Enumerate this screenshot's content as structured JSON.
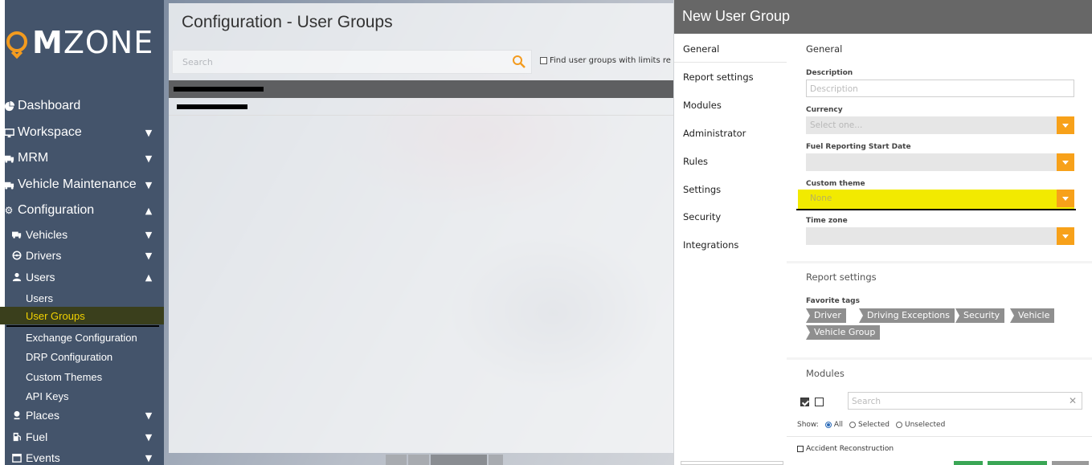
{
  "logo": {
    "bold": "M",
    "rest": "ZONE"
  },
  "nav": [
    {
      "label": "Dashboard",
      "icon": "pie-chart-icon",
      "chevron": ""
    },
    {
      "label": "Workspace",
      "icon": "monitor-icon",
      "chevron": "down"
    },
    {
      "label": "MRM",
      "icon": "truck-icon",
      "chevron": "down"
    },
    {
      "label": "Vehicle Maintenance",
      "icon": "truck-icon",
      "chevron": "down"
    },
    {
      "label": "Configuration",
      "icon": "gear-icon",
      "chevron": "up"
    },
    {
      "label": "Vehicles",
      "icon": "truck-icon",
      "chevron": "down"
    },
    {
      "label": "Drivers",
      "icon": "steering-wheel-icon",
      "chevron": "down"
    },
    {
      "label": "Users",
      "icon": "user-icon",
      "chevron": "up"
    },
    {
      "label": "Users"
    },
    {
      "label": "User Groups",
      "active": true
    },
    {
      "label": "Exchange Configuration"
    },
    {
      "label": "DRP Configuration"
    },
    {
      "label": "Custom Themes"
    },
    {
      "label": "API Keys"
    },
    {
      "label": "Places",
      "icon": "map-pin-icon",
      "chevron": "down"
    },
    {
      "label": "Fuel",
      "icon": "fuel-pump-icon",
      "chevron": "down"
    },
    {
      "label": "Events",
      "icon": "calendar-icon",
      "chevron": "down"
    }
  ],
  "main": {
    "title": "Configuration - User Groups",
    "search_placeholder": "Search",
    "limits_label": "Find user groups with limits re"
  },
  "panel": {
    "title": "New User Group",
    "tabs": [
      "General",
      "Report settings",
      "Modules",
      "Administrator",
      "Rules",
      "Settings",
      "Security",
      "Integrations"
    ],
    "general": {
      "title": "General",
      "description_label": "Description",
      "description_placeholder": "Description",
      "currency_label": "Currency",
      "currency_value": "Select one...",
      "fuel_label": "Fuel Reporting Start Date",
      "fuel_value": "",
      "theme_label": "Custom theme",
      "theme_value": "None",
      "timezone_label": "Time zone",
      "timezone_value": ""
    },
    "report": {
      "title": "Report settings",
      "favorite_label": "Favorite tags",
      "tags": [
        "Driver",
        "Driving Exceptions",
        "Security",
        "Vehicle",
        "Vehicle Group"
      ]
    },
    "modules": {
      "title": "Modules",
      "search_placeholder": "Search",
      "show_label": "Show:",
      "filters": [
        "All",
        "Selected",
        "Unselected"
      ],
      "selected_filter": "All",
      "items": [
        "Accident Reconstruction"
      ]
    }
  },
  "colors": {
    "accent": "#f7a11a",
    "highlight": "#f2ea00",
    "sidebar": "#44546b",
    "header": "#676767"
  }
}
